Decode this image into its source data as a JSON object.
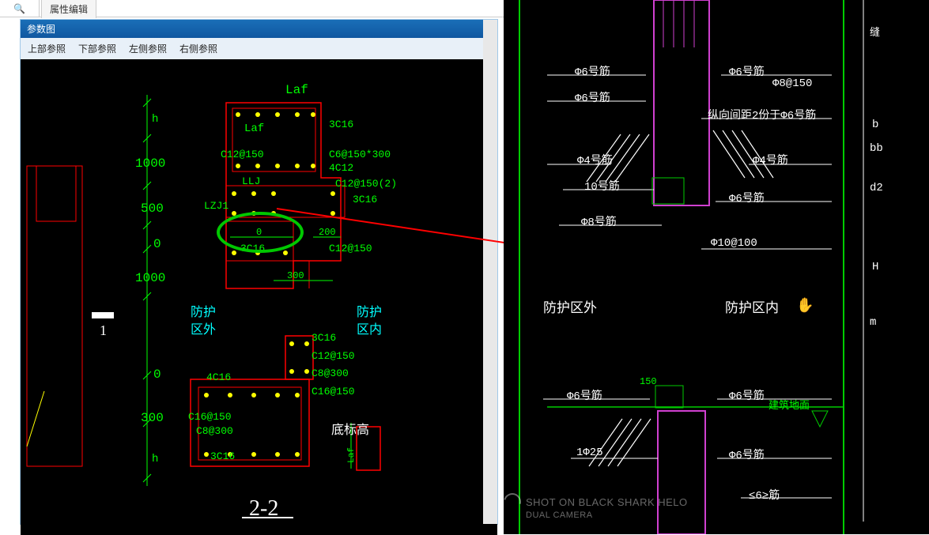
{
  "tabs": {
    "attribute_edit": "属性编辑"
  },
  "window": {
    "title": "参数图"
  },
  "menu": {
    "top_ref": "上部参照",
    "bottom_ref": "下部参照",
    "left_ref": "左侧参照",
    "right_ref": "右侧参照"
  },
  "left_drawing": {
    "laf_top": "Laf",
    "laf_left": "Laf",
    "h_top": "h",
    "h_bottom": "h",
    "dim_1000_top": "1000",
    "dim_500": "500",
    "dim_0_a": "0",
    "dim_1000_bottom": "1000",
    "dim_0_b": "0",
    "dim_300_bottom": "300",
    "dim_0_inner": "0",
    "dim_200": "200",
    "dim_300_inner": "300",
    "c12_150": "C12@150",
    "c6_150_300": "C6@150*300",
    "c12_150_2": "C12@150(2)",
    "r_3c16_top": "3C16",
    "r_4c12": "4C12",
    "r_3c16_b": "3C16",
    "llj": "LLJ",
    "lzj1": "LZJ1",
    "r_3c16_c": "3C16",
    "c12_150_b": "C12@150",
    "protect_out": "防护\n区外",
    "protect_in": "防护\n区内",
    "r_3c16_d": "3C16",
    "c12_150_c": "C12@150",
    "c8_300": "C8@300",
    "c16_150": "C16@150",
    "r_4c16": "4C16",
    "c16_150_b": "C16@150",
    "c8_300_b": "C8@300",
    "r_3c16_e": "3C16",
    "bottom_elev": "底标高",
    "laf_side": "Laf",
    "section_title": "2-2",
    "ruler": "1"
  },
  "right_drawing": {
    "phi6_top_l": "Φ6号筋",
    "phi6_top_r": "Φ6号筋",
    "phi8_150": "Φ8@150",
    "spacing_note": "纵向间距2份于Φ6号筋",
    "phi4_l": "Φ4号筋",
    "phi4_r": "Φ4号筋",
    "phi6_mid": "Φ6号筋",
    "num10": "10号筋",
    "phi8_bottom": "Φ8号筋",
    "phi10_100": "Φ10@100",
    "protect_out": "防护区外",
    "protect_in": "防护区内",
    "dim_150": "150",
    "phi6_lower": "Φ6号筋",
    "phi6_lowest": "Φ6号筋",
    "ground": "建筑地面",
    "r_1_25": "1Φ25",
    "d6_ge": "≤6≥筋",
    "dim_b": "b",
    "dim_bb": "bb",
    "dim_d2": "d2",
    "dim_H": "H",
    "dim_m": "m",
    "gap": "缝",
    "hand_icon": "✋",
    "watermark_line1": "SHOT ON BLACK SHARK HELO",
    "watermark_line2": "DUAL CAMERA"
  }
}
